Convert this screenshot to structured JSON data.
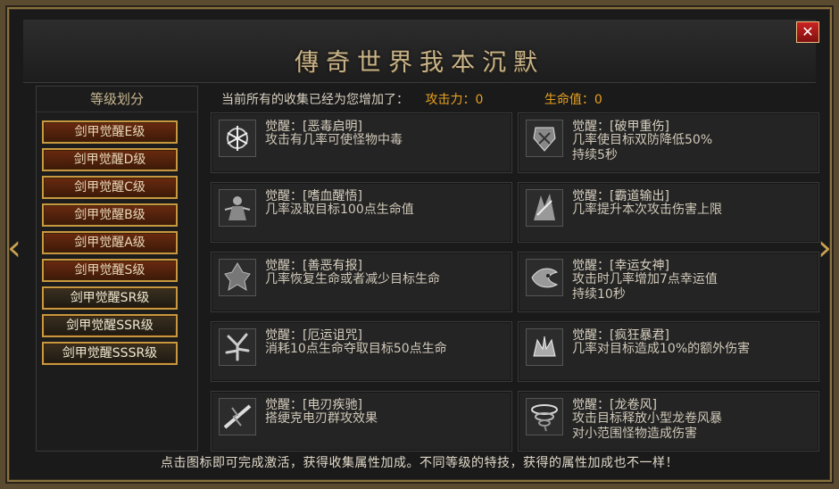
{
  "window": {
    "title": "傳奇世界我本沉默",
    "close_label": "✕"
  },
  "nav": {
    "prev_label": "‹",
    "next_label": "›"
  },
  "sidebar": {
    "title": "等级划分",
    "items": [
      {
        "label": "剑甲觉醒E级"
      },
      {
        "label": "剑甲觉醒D级"
      },
      {
        "label": "剑甲觉醒C级"
      },
      {
        "label": "剑甲觉醒B级"
      },
      {
        "label": "剑甲觉醒A级"
      },
      {
        "label": "剑甲觉醒S级"
      },
      {
        "label": "剑甲觉醒SR级"
      },
      {
        "label": "剑甲觉醒SSR级"
      },
      {
        "label": "剑甲觉醒SSSR级"
      }
    ]
  },
  "summary": {
    "text": "当前所有的收集已经为您增加了：",
    "attack_label": "攻击力：",
    "attack_value": "0",
    "hp_label": "生命值：",
    "hp_value": "0"
  },
  "skills": [
    {
      "name": "觉醒：[恶毒启明]",
      "desc": "攻击有几率可使怪物中毒",
      "icon": "poison-skill-icon"
    },
    {
      "name": "觉醒：[破甲重伤]",
      "desc": "几率使目标双防降低50%\n持续5秒",
      "icon": "armor-break-skill-icon"
    },
    {
      "name": "觉醒：[嗜血醒悟]",
      "desc": "几率汲取目标100点生命值",
      "icon": "bloodthirst-skill-icon"
    },
    {
      "name": "觉醒：[霸道输出]",
      "desc": "几率提升本次攻击伤害上限",
      "icon": "domineering-skill-icon"
    },
    {
      "name": "觉醒：[善恶有报]",
      "desc": "几率恢复生命或者减少目标生命",
      "icon": "karma-skill-icon"
    },
    {
      "name": "觉醒：[幸运女神]",
      "desc": "攻击时几率增加7点幸运值\n持续10秒",
      "icon": "luck-goddess-skill-icon"
    },
    {
      "name": "觉醒：[厄运诅咒]",
      "desc": "消耗10点生命夺取目标50点生命",
      "icon": "curse-skill-icon"
    },
    {
      "name": "觉醒：[疯狂暴君]",
      "desc": "几率对目标造成10%的额外伤害",
      "icon": "mad-tyrant-skill-icon"
    },
    {
      "name": "觉醒：[电刃疾驰]",
      "desc": "搭绠克电刃群攻效果",
      "icon": "lightning-blade-skill-icon"
    },
    {
      "name": "觉醒：[龙卷风]",
      "desc": "攻击目标释放小型龙卷风暴\n对小范围怪物造成伤害",
      "icon": "tornado-skill-icon"
    }
  ],
  "footer": {
    "text": "点击图标即可完成激活，获得收集属性加成。不同等级的特技，获得的属性加成也不一样！"
  },
  "colors": {
    "accent": "#e8a020",
    "button_border": "#c89840",
    "button_fill": "#6a2a10"
  }
}
